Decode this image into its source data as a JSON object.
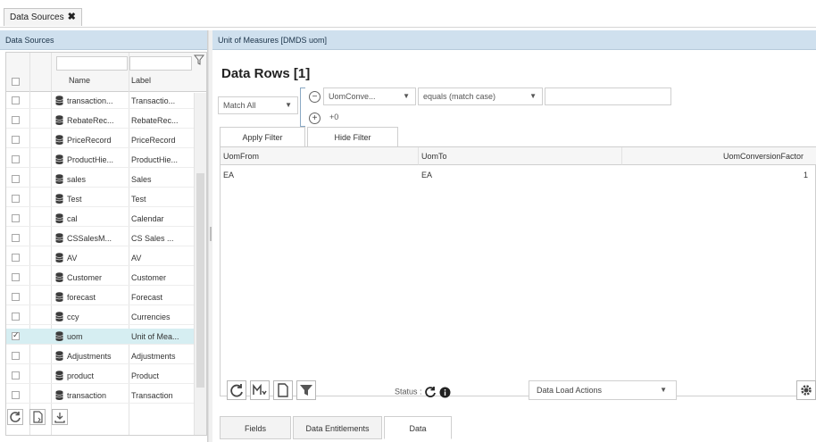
{
  "top_tab": {
    "label": "Data Sources",
    "close": "✖"
  },
  "left_panel": {
    "title": "Data Sources",
    "columns": {
      "name": "Name",
      "label": "Label"
    },
    "rows": [
      {
        "name": "transaction...",
        "label": "Transactio...",
        "checked": false
      },
      {
        "name": "RebateRec...",
        "label": "RebateRec...",
        "checked": false
      },
      {
        "name": "PriceRecord",
        "label": "PriceRecord",
        "checked": false
      },
      {
        "name": "ProductHie...",
        "label": "ProductHie...",
        "checked": false
      },
      {
        "name": "sales",
        "label": "Sales",
        "checked": false
      },
      {
        "name": "Test",
        "label": "Test",
        "checked": false
      },
      {
        "name": "cal",
        "label": "Calendar",
        "checked": false
      },
      {
        "name": "CSSalesM...",
        "label": "CS Sales ...",
        "checked": false
      },
      {
        "name": "AV",
        "label": "AV",
        "checked": false
      },
      {
        "name": "Customer",
        "label": "Customer",
        "checked": false
      },
      {
        "name": "forecast",
        "label": "Forecast",
        "checked": false
      },
      {
        "name": "ccy",
        "label": "Currencies",
        "checked": false
      },
      {
        "name": "uom",
        "label": "Unit of Mea...",
        "checked": true
      },
      {
        "name": "Adjustments",
        "label": "Adjustments",
        "checked": false
      },
      {
        "name": "product",
        "label": "Product",
        "checked": false
      },
      {
        "name": "transaction",
        "label": "Transaction",
        "checked": false
      }
    ]
  },
  "right_panel": {
    "header": "Unit of Measures  [DMDS uom]",
    "title": "Data Rows [1]",
    "filter": {
      "match": "Match All",
      "field": "UomConve...",
      "operator": "equals (match case)",
      "value": "",
      "plus_count": "+0"
    },
    "buttons": {
      "apply": "Apply Filter",
      "hide": "Hide Filter"
    },
    "table": {
      "columns": [
        "UomFrom",
        "UomTo",
        "UomConversionFactor"
      ],
      "rows": [
        [
          "EA",
          "EA",
          "1"
        ]
      ]
    },
    "status_label": "Status :",
    "data_load_actions": "Data Load Actions",
    "bottom_tabs": [
      "Fields",
      "Data Entitlements",
      "Data"
    ],
    "active_tab": "Data"
  }
}
